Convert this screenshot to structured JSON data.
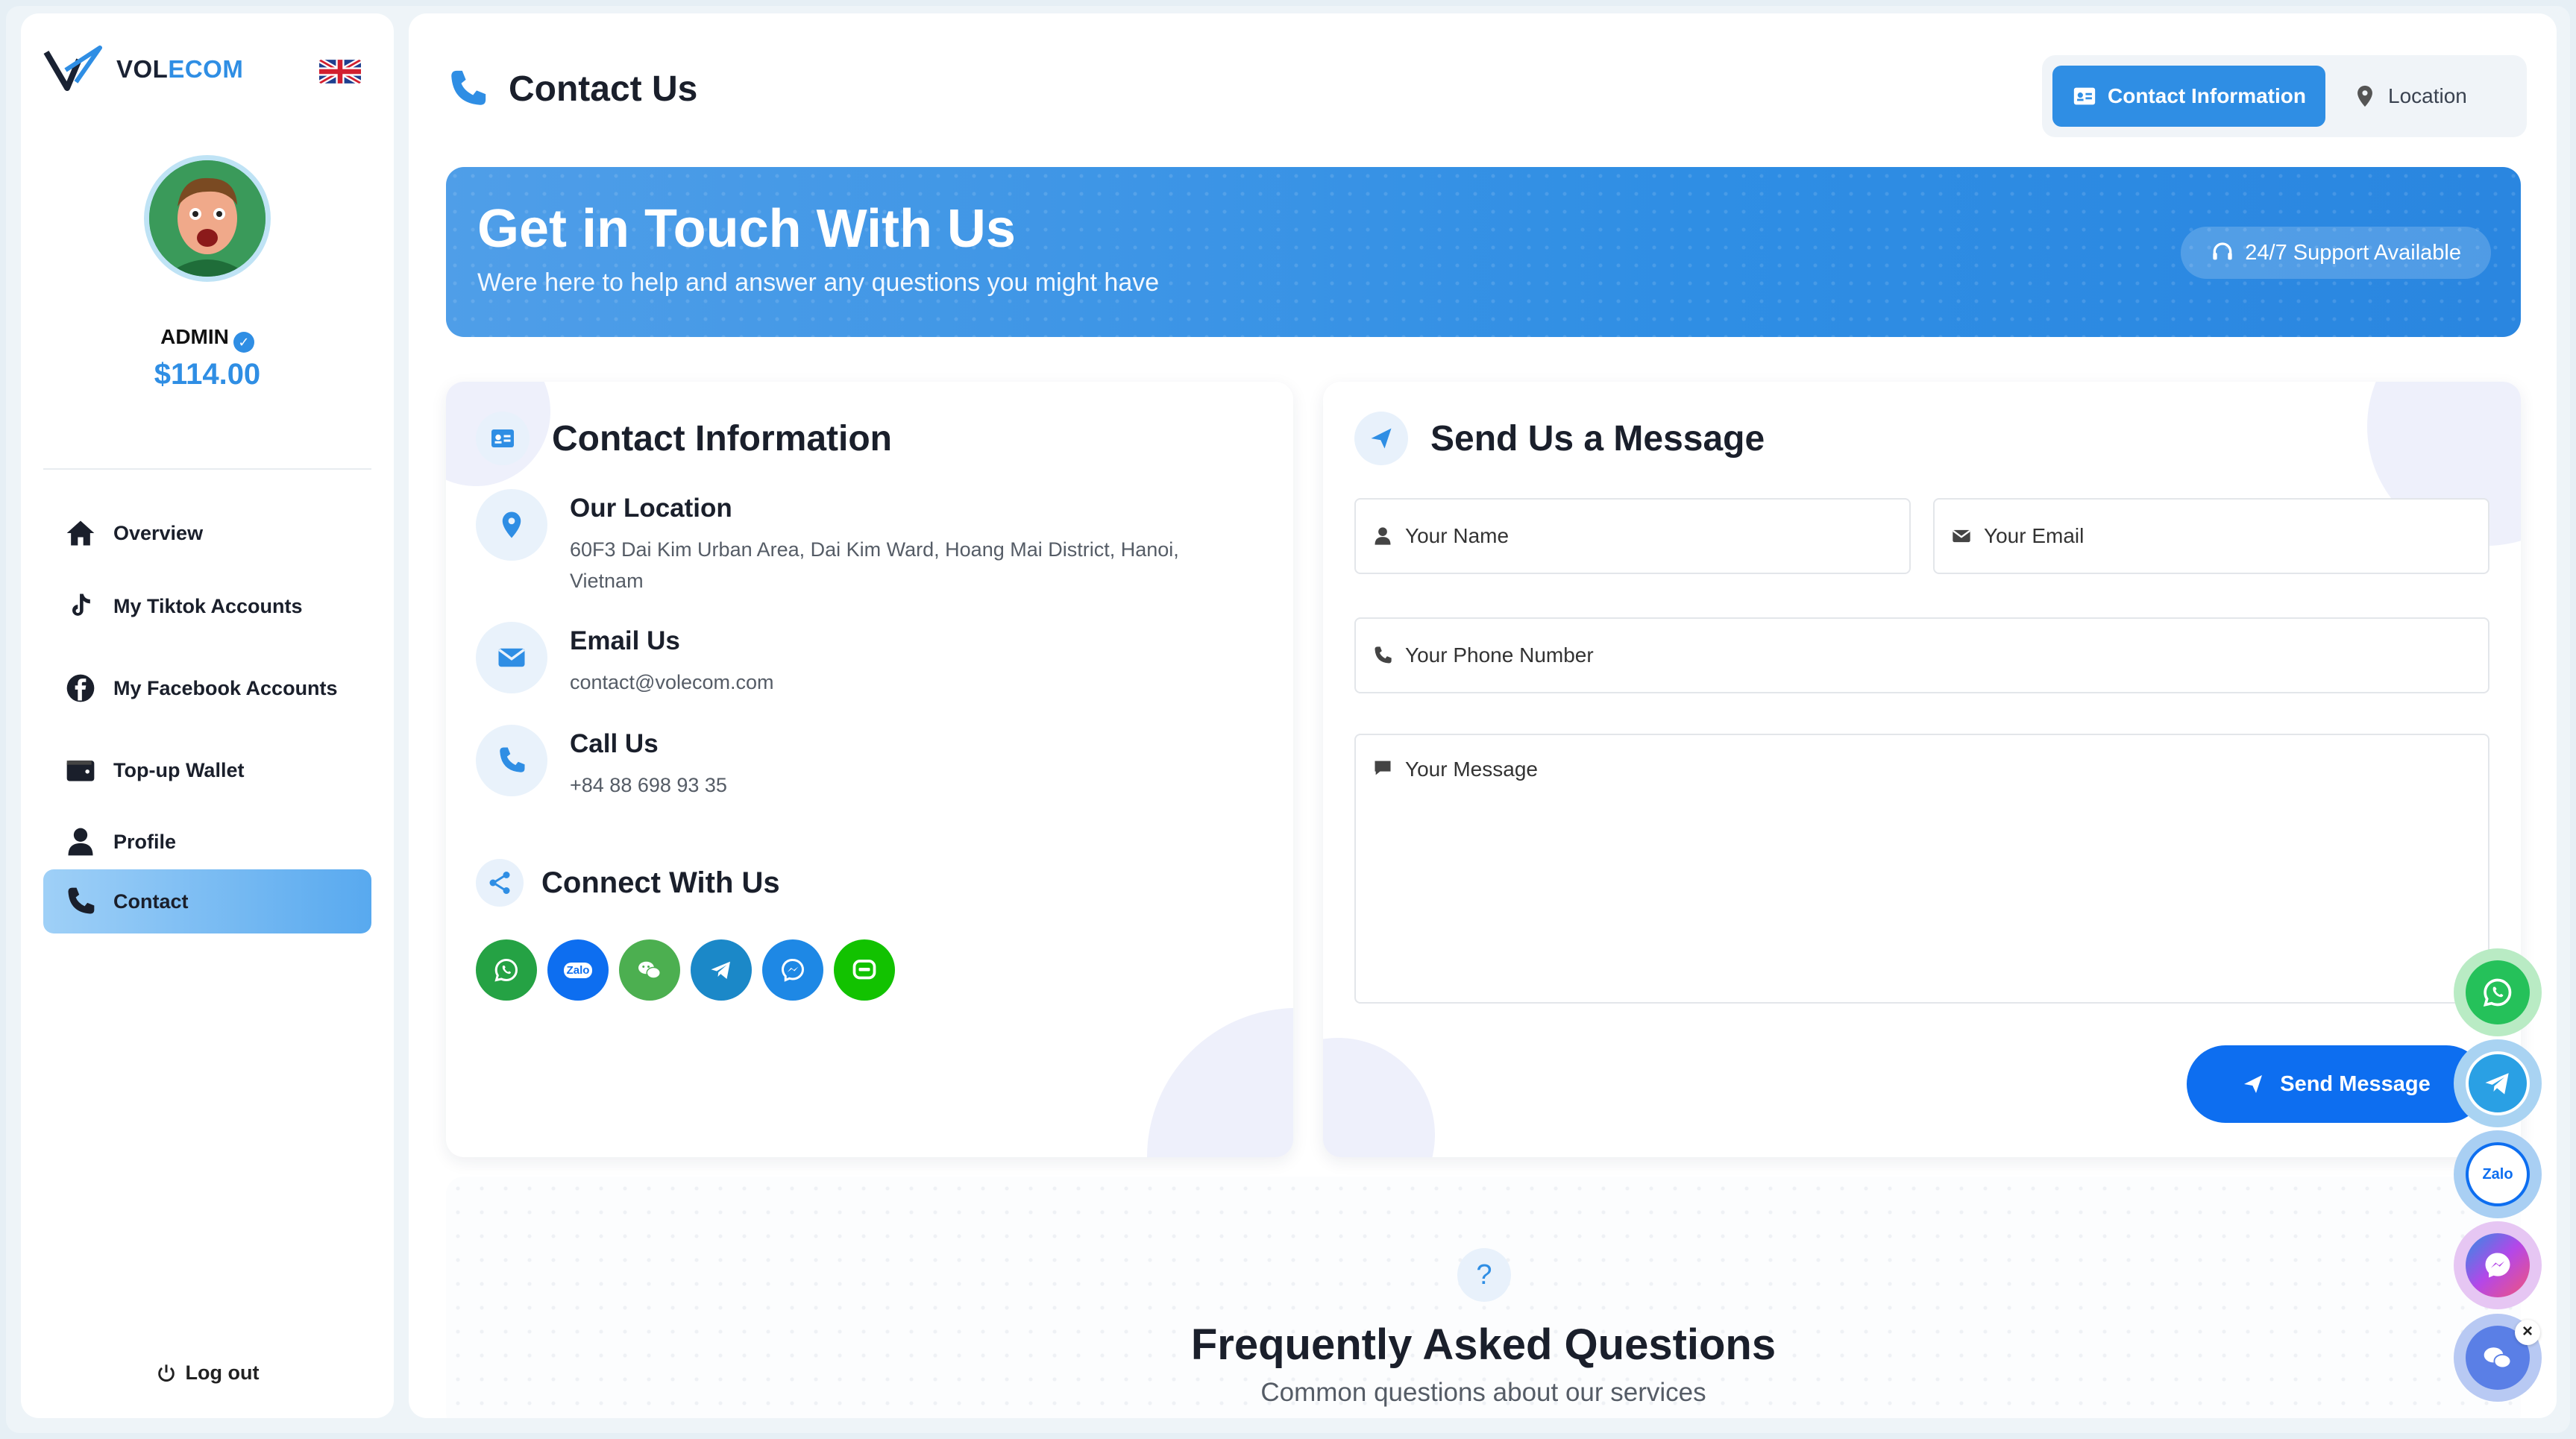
{
  "brand": {
    "name_part1": "VOL",
    "name_part2": "ECOM"
  },
  "user": {
    "name": "ADMIN",
    "balance": "$114.00"
  },
  "nav": {
    "items": [
      {
        "label": "Overview",
        "icon": "home-icon"
      },
      {
        "label": "My Tiktok Accounts",
        "icon": "tiktok-icon"
      },
      {
        "label": "My Facebook Accounts",
        "icon": "facebook-icon"
      },
      {
        "label": "Top-up Wallet",
        "icon": "wallet-icon"
      },
      {
        "label": "Profile",
        "icon": "user-icon"
      },
      {
        "label": "Contact",
        "icon": "phone-icon",
        "active": true
      }
    ],
    "logout": "Log out"
  },
  "page": {
    "title": "Contact Us"
  },
  "tabs": [
    {
      "label": "Contact Information",
      "active": true
    },
    {
      "label": "Location"
    }
  ],
  "hero": {
    "title": "Get in Touch With Us",
    "subtitle": "Were here to help and answer any questions you might have",
    "badge": "24/7 Support Available"
  },
  "contact": {
    "heading": "Contact Information",
    "location_title": "Our Location",
    "location_line1": "60F3 Dai Kim Urban Area, Dai Kim Ward, Hoang Mai District, Hanoi,",
    "location_line2": "Vietnam",
    "email_title": "Email Us",
    "email": "contact@volecom.com",
    "call_title": "Call Us",
    "phone": "+84 88 698 93 35",
    "connect_heading": "Connect With Us",
    "socials": [
      {
        "name": "whatsapp",
        "color": "#25a244"
      },
      {
        "name": "zalo",
        "color": "#0d6ef0",
        "text": "Zalo"
      },
      {
        "name": "wechat",
        "color": "#4caf50"
      },
      {
        "name": "telegram",
        "color": "#1b88c8"
      },
      {
        "name": "messenger",
        "color": "#1e88e5"
      },
      {
        "name": "line",
        "color": "#12c200"
      }
    ]
  },
  "form": {
    "heading": "Send Us a Message",
    "name_placeholder": "Your Name",
    "email_placeholder": "Your Email",
    "phone_placeholder": "Your Phone Number",
    "message_placeholder": "Your Message",
    "submit": "Send Message"
  },
  "faq": {
    "icon_text": "?",
    "title": "Frequently Asked Questions",
    "subtitle": "Common questions about our services"
  },
  "floating": {
    "zalo_text": "Zalo",
    "close": "×"
  },
  "colors": {
    "accent": "#2f8ee4",
    "button": "#0d6ef0"
  }
}
